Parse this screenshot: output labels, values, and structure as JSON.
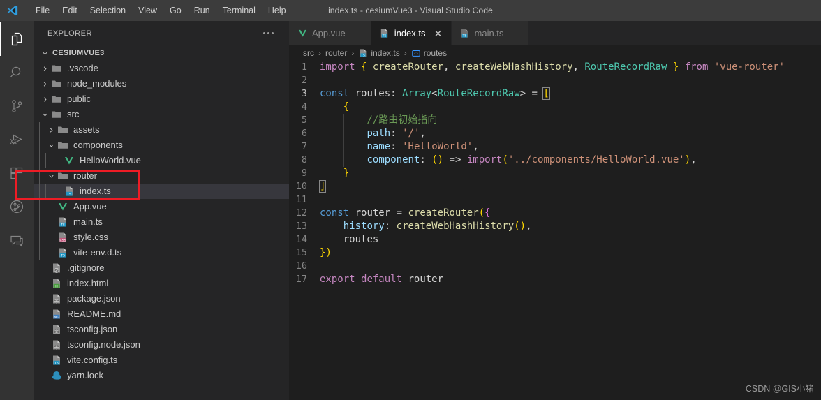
{
  "titlebar": {
    "logo_icon": "vscode-logo-icon",
    "menus": [
      "File",
      "Edit",
      "Selection",
      "View",
      "Go",
      "Run",
      "Terminal",
      "Help"
    ],
    "window_title": "index.ts - cesiumVue3 - Visual Studio Code"
  },
  "activitybar": {
    "items": [
      {
        "name": "explorer",
        "icon": "files-icon",
        "active": true
      },
      {
        "name": "search",
        "icon": "search-icon",
        "active": false
      },
      {
        "name": "source-control",
        "icon": "source-control-icon",
        "active": false
      },
      {
        "name": "run-and-debug",
        "icon": "run-debug-icon",
        "active": false
      },
      {
        "name": "extensions",
        "icon": "extensions-icon",
        "active": false
      },
      {
        "name": "gitlens",
        "icon": "gitlens-circle-icon",
        "active": false
      },
      {
        "name": "remote-explorer",
        "icon": "comment-remote-icon",
        "active": false
      }
    ]
  },
  "sidebar": {
    "header_title": "EXPLORER",
    "more_actions_icon": "ellipsis-icon",
    "root_label": "CESIUMVUE3",
    "root_expanded": true,
    "tree": [
      {
        "label": ".vscode",
        "type": "folder",
        "depth": 1,
        "expanded": false,
        "icon": "folder-icon",
        "selected": false
      },
      {
        "label": "node_modules",
        "type": "folder",
        "depth": 1,
        "expanded": false,
        "icon": "folder-icon",
        "selected": false
      },
      {
        "label": "public",
        "type": "folder",
        "depth": 1,
        "expanded": false,
        "icon": "folder-icon",
        "selected": false
      },
      {
        "label": "src",
        "type": "folder",
        "depth": 1,
        "expanded": true,
        "icon": "folder-icon",
        "selected": false
      },
      {
        "label": "assets",
        "type": "folder",
        "depth": 2,
        "expanded": false,
        "icon": "folder-icon",
        "selected": false
      },
      {
        "label": "components",
        "type": "folder",
        "depth": 2,
        "expanded": true,
        "icon": "folder-icon",
        "selected": false
      },
      {
        "label": "HelloWorld.vue",
        "type": "file",
        "depth": 3,
        "icon": "vue-icon",
        "selected": false
      },
      {
        "label": "router",
        "type": "folder",
        "depth": 2,
        "expanded": true,
        "icon": "folder-icon",
        "selected": false
      },
      {
        "label": "index.ts",
        "type": "file",
        "depth": 3,
        "icon": "ts-icon",
        "selected": true
      },
      {
        "label": "App.vue",
        "type": "file",
        "depth": 2,
        "icon": "vue-icon",
        "selected": false
      },
      {
        "label": "main.ts",
        "type": "file",
        "depth": 2,
        "icon": "ts-icon",
        "selected": false
      },
      {
        "label": "style.css",
        "type": "file",
        "depth": 2,
        "icon": "css-icon",
        "selected": false
      },
      {
        "label": "vite-env.d.ts",
        "type": "file",
        "depth": 2,
        "icon": "ts-icon",
        "selected": false
      },
      {
        "label": ".gitignore",
        "type": "file",
        "depth": 1,
        "icon": "git-icon",
        "selected": false
      },
      {
        "label": "index.html",
        "type": "file",
        "depth": 1,
        "icon": "html-icon",
        "selected": false
      },
      {
        "label": "package.json",
        "type": "file",
        "depth": 1,
        "icon": "json-icon",
        "selected": false
      },
      {
        "label": "README.md",
        "type": "file",
        "depth": 1,
        "icon": "md-icon",
        "selected": false
      },
      {
        "label": "tsconfig.json",
        "type": "file",
        "depth": 1,
        "icon": "json-icon",
        "selected": false
      },
      {
        "label": "tsconfig.node.json",
        "type": "file",
        "depth": 1,
        "icon": "json-icon",
        "selected": false
      },
      {
        "label": "vite.config.ts",
        "type": "file",
        "depth": 1,
        "icon": "ts-icon",
        "selected": false
      },
      {
        "label": "yarn.lock",
        "type": "file",
        "depth": 1,
        "icon": "yarn-icon",
        "selected": false
      }
    ],
    "annotation": {
      "color": "#ee1c25",
      "target_rows": [
        "router",
        "index.ts"
      ]
    }
  },
  "editor": {
    "tabs": [
      {
        "label": "App.vue",
        "icon": "vue-icon",
        "active": false,
        "closable": false
      },
      {
        "label": "index.ts",
        "icon": "ts-icon",
        "active": true,
        "closable": true,
        "close_icon": "close-icon"
      },
      {
        "label": "main.ts",
        "icon": "ts-icon",
        "active": false,
        "closable": false
      }
    ],
    "breadcrumb": [
      {
        "label": "src",
        "icon": null
      },
      {
        "label": "router",
        "icon": null
      },
      {
        "label": "index.ts",
        "icon": "ts-icon"
      },
      {
        "label": "routes",
        "icon": "symbol-variable-icon"
      }
    ],
    "breadcrumb_separator": "›",
    "current_line": 3,
    "code_lines": [
      {
        "n": 1,
        "text": "import { createRouter, createWebHashHistory, RouteRecordRaw } from 'vue-router'"
      },
      {
        "n": 2,
        "text": ""
      },
      {
        "n": 3,
        "text": "const routes: Array<RouteRecordRaw> = ["
      },
      {
        "n": 4,
        "text": "    {"
      },
      {
        "n": 5,
        "text": "        //路由初始指向"
      },
      {
        "n": 6,
        "text": "        path: '/',"
      },
      {
        "n": 7,
        "text": "        name: 'HelloWorld',"
      },
      {
        "n": 8,
        "text": "        component: () => import('../components/HelloWorld.vue'),"
      },
      {
        "n": 9,
        "text": "    }"
      },
      {
        "n": 10,
        "text": "]"
      },
      {
        "n": 11,
        "text": ""
      },
      {
        "n": 12,
        "text": "const router = createRouter({"
      },
      {
        "n": 13,
        "text": "    history: createWebHashHistory(),"
      },
      {
        "n": 14,
        "text": "    routes"
      },
      {
        "n": 15,
        "text": "})"
      },
      {
        "n": 16,
        "text": ""
      },
      {
        "n": 17,
        "text": "export default router"
      }
    ]
  },
  "watermark": "CSDN @GIS小猪",
  "colors": {
    "titlebar_bg": "#3c3c3c",
    "activitybar_bg": "#333333",
    "sidebar_bg": "#252526",
    "editor_bg": "#1e1e1e",
    "selection_bg": "#37373d",
    "annotation_red": "#ee1c25",
    "accent_blue": "#0e639c"
  }
}
